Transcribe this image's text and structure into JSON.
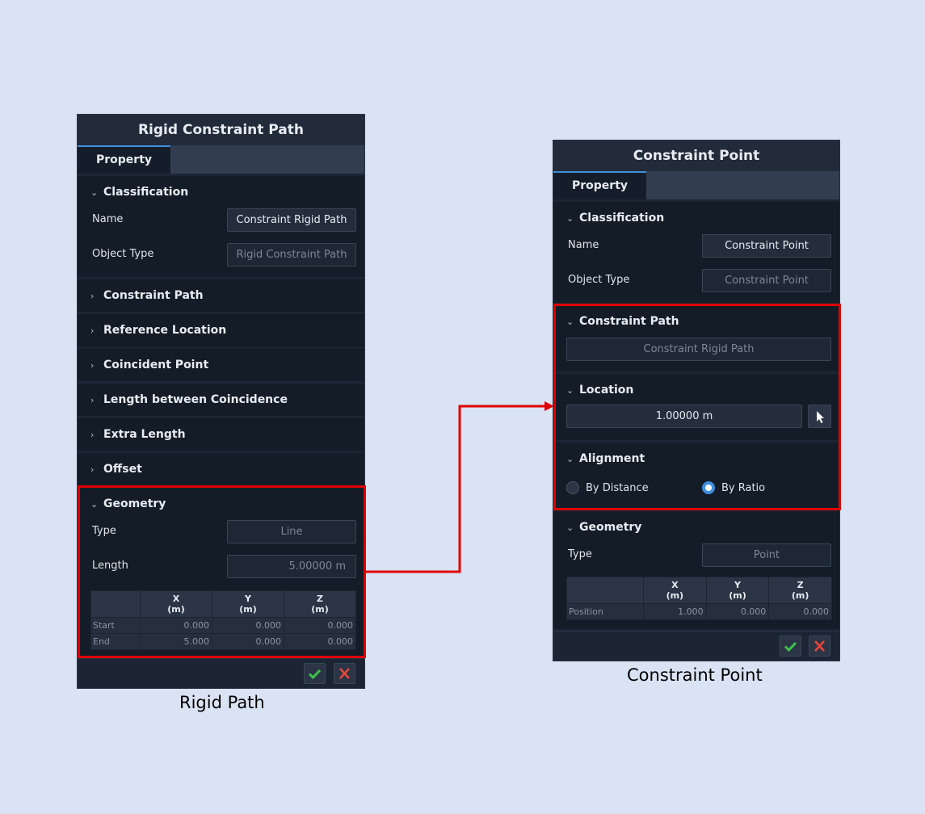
{
  "left_panel": {
    "title": "Rigid Constraint Path",
    "tab": "Property",
    "classification": {
      "header": "Classification",
      "name_label": "Name",
      "name_value": "Constraint Rigid Path",
      "type_label": "Object Type",
      "type_value": "Rigid Constraint Path"
    },
    "sections": [
      "Constraint Path",
      "Reference Location",
      "Coincident Point",
      "Length between Coincidence",
      "Extra Length",
      "Offset"
    ],
    "geometry": {
      "header": "Geometry",
      "type_label": "Type",
      "type_value": "Line",
      "length_label": "Length",
      "length_value": "5.00000 m",
      "columns": [
        {
          "axis": "X",
          "unit": "(m)"
        },
        {
          "axis": "Y",
          "unit": "(m)"
        },
        {
          "axis": "Z",
          "unit": "(m)"
        }
      ],
      "rows": [
        {
          "label": "Start",
          "values": [
            "0.000",
            "0.000",
            "0.000"
          ]
        },
        {
          "label": "End",
          "values": [
            "5.000",
            "0.000",
            "0.000"
          ]
        }
      ]
    },
    "caption": "Rigid Path"
  },
  "right_panel": {
    "title": "Constraint Point",
    "tab": "Property",
    "classification": {
      "header": "Classification",
      "name_label": "Name",
      "name_value": "Constraint Point",
      "type_label": "Object Type",
      "type_value": "Constraint Point"
    },
    "constraint_path": {
      "header": "Constraint Path",
      "value": "Constraint Rigid Path"
    },
    "location": {
      "header": "Location",
      "value": "1.00000 m"
    },
    "alignment": {
      "header": "Alignment",
      "option1": "By Distance",
      "option2": "By Ratio",
      "selected": "By Ratio"
    },
    "geometry": {
      "header": "Geometry",
      "type_label": "Type",
      "type_value": "Point",
      "columns": [
        {
          "axis": "X",
          "unit": "(m)"
        },
        {
          "axis": "Y",
          "unit": "(m)"
        },
        {
          "axis": "Z",
          "unit": "(m)"
        }
      ],
      "rows": [
        {
          "label": "Position",
          "values": [
            "1.000",
            "0.000",
            "0.000"
          ]
        }
      ]
    },
    "caption": "Constraint Point"
  },
  "colors": {
    "highlight": "#e00000",
    "accent": "#3f8fe0",
    "ok": "#3ec24a",
    "cancel": "#e8453c"
  },
  "icons": {
    "ok": "check-icon",
    "cancel": "close-icon",
    "picker": "cursor-arrow-icon"
  }
}
